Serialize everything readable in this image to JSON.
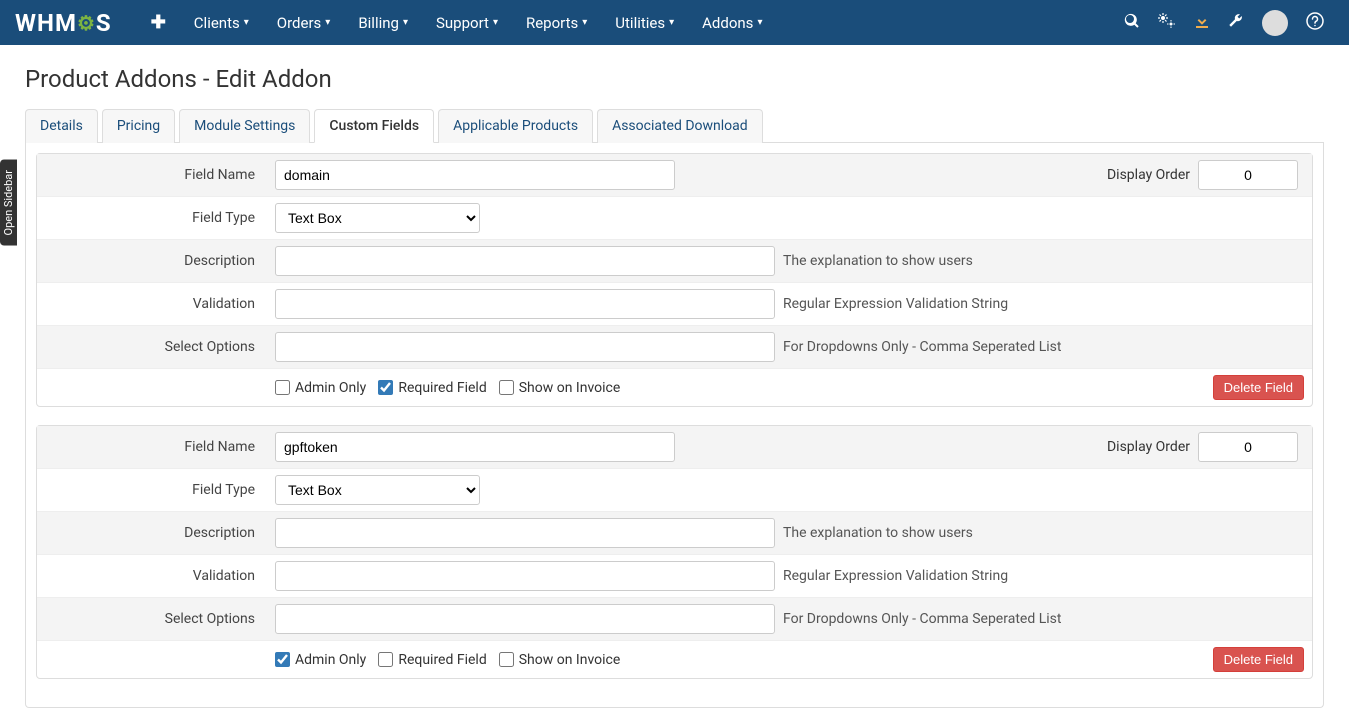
{
  "brand": {
    "pre": "WHM",
    "post": "S"
  },
  "nav": {
    "items": [
      "Clients",
      "Orders",
      "Billing",
      "Support",
      "Reports",
      "Utilities",
      "Addons"
    ]
  },
  "sidebar_tab": "Open Sidebar",
  "page_title": "Product Addons - Edit Addon",
  "tabs": [
    {
      "label": "Details",
      "active": false
    },
    {
      "label": "Pricing",
      "active": false
    },
    {
      "label": "Module Settings",
      "active": false
    },
    {
      "label": "Custom Fields",
      "active": true
    },
    {
      "label": "Applicable Products",
      "active": false
    },
    {
      "label": "Associated Download",
      "active": false
    }
  ],
  "labels": {
    "field_name": "Field Name",
    "display_order": "Display Order",
    "field_type": "Field Type",
    "description": "Description",
    "validation": "Validation",
    "select_options": "Select Options",
    "admin_only": "Admin Only",
    "required_field": "Required Field",
    "show_on_invoice": "Show on Invoice",
    "delete_field": "Delete Field"
  },
  "hints": {
    "description": "The explanation to show users",
    "validation": "Regular Expression Validation String",
    "select_options": "For Dropdowns Only - Comma Seperated List"
  },
  "field_type_option": "Text Box",
  "fields": [
    {
      "name": "domain",
      "display_order": "0",
      "type": "Text Box",
      "description": "",
      "validation": "",
      "select_options": "",
      "admin_only": false,
      "required": true,
      "show_on_invoice": false
    },
    {
      "name": "gpftoken",
      "display_order": "0",
      "type": "Text Box",
      "description": "",
      "validation": "",
      "select_options": "",
      "admin_only": true,
      "required": false,
      "show_on_invoice": false
    }
  ]
}
